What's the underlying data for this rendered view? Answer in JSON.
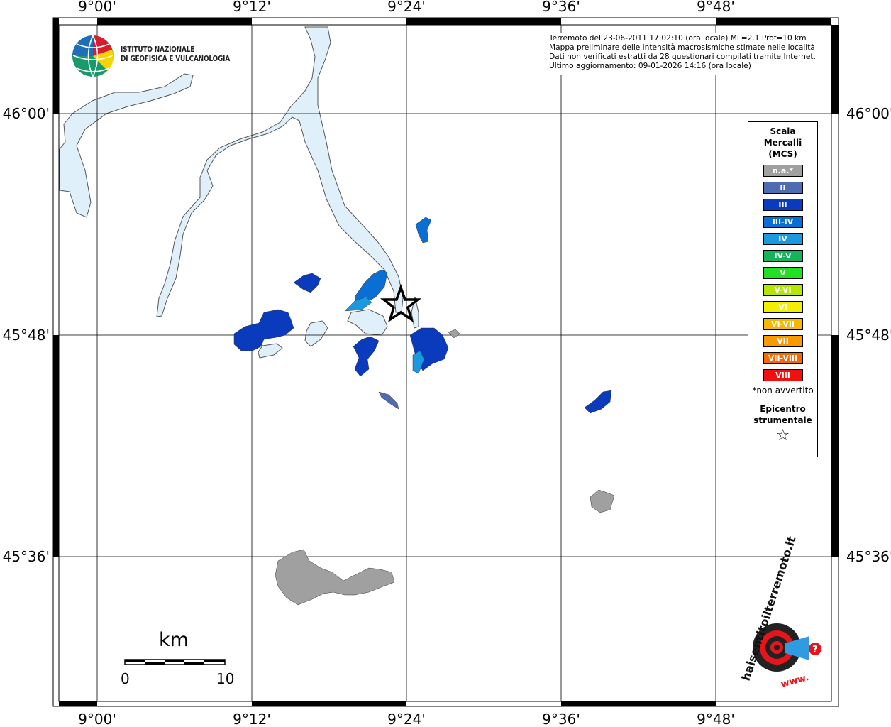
{
  "map": {
    "lon_ticks": [
      "9°00'",
      "9°12'",
      "9°24'",
      "9°36'",
      "9°48'"
    ],
    "lat_ticks": [
      "46°00'",
      "45°48'",
      "45°36'"
    ],
    "info_lines": [
      "Terremoto del 23-06-2011 17:02:10 (ora locale) ML=2.1 Prof=10 km",
      "Mappa preliminare delle intensità macrosismiche stimate nelle località",
      "Dati non verificati estratti da 28 questionari compilati tramite Internet.",
      "Ultimo aggiornamento: 09-01-2026 14:16 (ora locale)"
    ],
    "colors": {
      "water": "#dff0fb",
      "na": "#a0a0a0",
      "int_II": "#4f6cb3",
      "int_III": "#0b3bbd",
      "int_IIIIV": "#0a6fd4",
      "int_IV": "#1a98e0"
    }
  },
  "institute": {
    "line1": "ISTITUTO NAZIONALE",
    "line2": "DI GEOFISICA E VULCANOLOGIA"
  },
  "legend": {
    "title_lines": [
      "Scala",
      "Mercalli",
      "(MCS)"
    ],
    "items": [
      {
        "label": "n.a.*",
        "color": "#a0a0a0"
      },
      {
        "label": "II",
        "color": "#4f6cb3"
      },
      {
        "label": "III",
        "color": "#0b3bbd"
      },
      {
        "label": "III-IV",
        "color": "#0a6fd4"
      },
      {
        "label": "IV",
        "color": "#1a98e0"
      },
      {
        "label": "IV-V",
        "color": "#15b45a"
      },
      {
        "label": "V",
        "color": "#22e022"
      },
      {
        "label": "V-VI",
        "color": "#b4e600"
      },
      {
        "label": "VI",
        "color": "#f2ef00"
      },
      {
        "label": "VI-VII",
        "color": "#f6b800"
      },
      {
        "label": "VII",
        "color": "#f89a00"
      },
      {
        "label": "VII-VIII",
        "color": "#f46a00"
      },
      {
        "label": "VIII",
        "color": "#f01010"
      }
    ],
    "note": "*non avvertito",
    "epicenter_lines": [
      "Epicentro",
      "strumentale"
    ],
    "epicenter_symbol": "☆"
  },
  "scale_bar": {
    "unit": "km",
    "min": "0",
    "max": "10"
  },
  "logo": {
    "text": "haisentitoilterremoto.it",
    "url": "www."
  }
}
